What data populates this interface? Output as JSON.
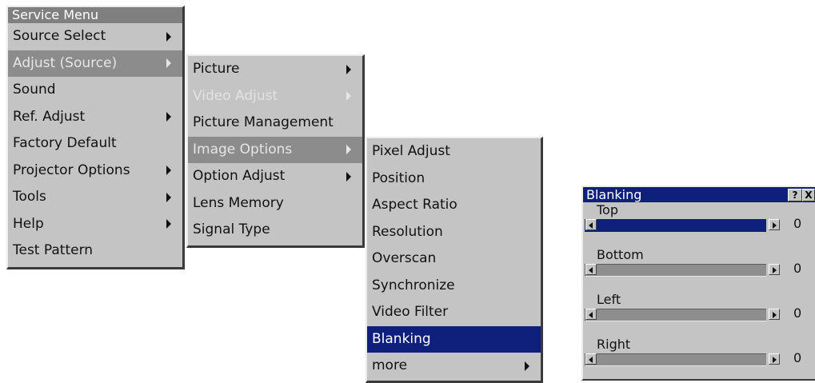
{
  "service_menu": {
    "title": "Service Menu",
    "items": [
      {
        "label": "Source Select"
      },
      {
        "label": "Adjust (Source)"
      },
      {
        "label": "Sound"
      },
      {
        "label": "Ref. Adjust"
      },
      {
        "label": "Factory Default"
      },
      {
        "label": "Projector Options"
      },
      {
        "label": "Tools"
      },
      {
        "label": "Help"
      },
      {
        "label": "Test Pattern"
      }
    ]
  },
  "adjust_menu": {
    "items": [
      {
        "label": "Picture"
      },
      {
        "label": "Video Adjust"
      },
      {
        "label": "Picture Management"
      },
      {
        "label": "Image Options"
      },
      {
        "label": "Option Adjust"
      },
      {
        "label": "Lens Memory"
      },
      {
        "label": "Signal Type"
      }
    ]
  },
  "image_options_menu": {
    "items": [
      {
        "label": "Pixel Adjust"
      },
      {
        "label": "Position"
      },
      {
        "label": "Aspect Ratio"
      },
      {
        "label": "Resolution"
      },
      {
        "label": "Overscan"
      },
      {
        "label": "Synchronize"
      },
      {
        "label": "Video Filter"
      },
      {
        "label": "Blanking"
      },
      {
        "label": "more"
      }
    ]
  },
  "blanking_dialog": {
    "title": "Blanking",
    "help_label": "?",
    "close_label": "X",
    "sliders": [
      {
        "label": "Top",
        "value": "0"
      },
      {
        "label": "Bottom",
        "value": "0"
      },
      {
        "label": "Left",
        "value": "0"
      },
      {
        "label": "Right",
        "value": "0"
      }
    ]
  },
  "colors": {
    "menu_bg": "#c4c4c4",
    "highlight_gray": "#8c8c8c",
    "highlight_blue": "#0f1f7c"
  }
}
